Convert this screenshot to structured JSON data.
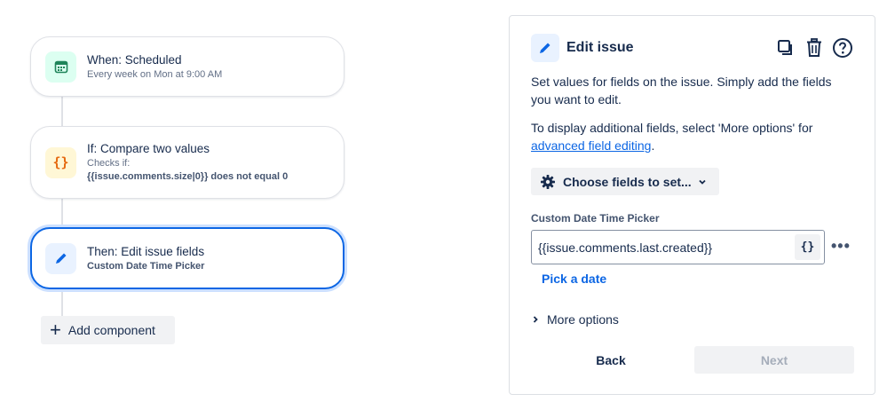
{
  "flow": {
    "trigger": {
      "title": "When: Scheduled",
      "subtitle": "Every week on Mon at 9:00 AM",
      "icon": "calendar-icon",
      "color": "#1f845a"
    },
    "condition": {
      "title": "If: Compare two values",
      "subtitle": "Checks if:",
      "detail": "{{issue.comments.size|0}} does not equal 0",
      "icon": "curly-braces-icon",
      "color": "#e56910"
    },
    "action": {
      "title": "Then: Edit issue fields",
      "subtitle": "Custom Date Time Picker",
      "icon": "pencil-icon",
      "color": "#0c66e4"
    },
    "add_component_label": "Add component"
  },
  "panel": {
    "title": "Edit issue",
    "icons": [
      "pencil-icon",
      "copy-icon",
      "trash-icon",
      "help-icon"
    ],
    "description_1": "Set values for fields on the issue. Simply add the fields you want to edit.",
    "description_2_prefix": "To display additional fields, select 'More options' for",
    "description_2_link": "advanced field editing",
    "description_2_suffix": ".",
    "choose_fields_label": "Choose fields to set...",
    "field_label": "Custom Date Time Picker",
    "field_value": "{{issue.comments.last.created}}",
    "smart_value_button": "{}",
    "more_dots": "•••",
    "pick_date_label": "Pick a date",
    "more_options_label": "More options",
    "back_label": "Back",
    "next_label": "Next"
  },
  "colors": {
    "accent": "#0c66e4",
    "text": "#172b4d",
    "subtle": "#626f86"
  }
}
